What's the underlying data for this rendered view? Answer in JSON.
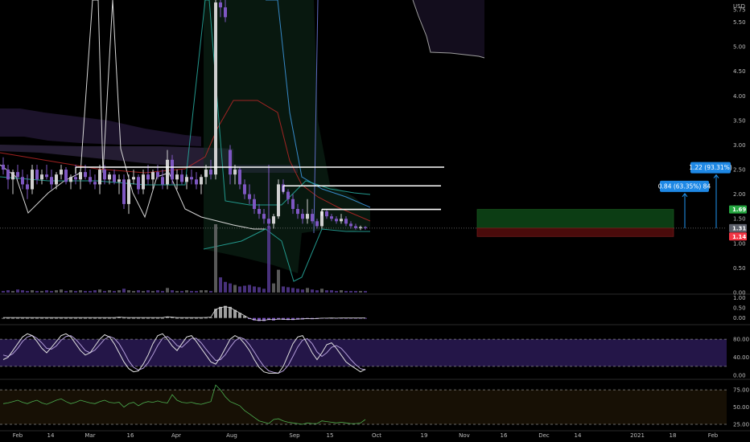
{
  "chart_data": {
    "type": "candlestick",
    "currency": "USD",
    "price_axis": {
      "ticks": [
        "5.75",
        "5.50",
        "5.00",
        "4.50",
        "4.00",
        "3.50",
        "3.00",
        "2.50",
        "2.00",
        "1.50",
        "1.00",
        "0.50",
        "0.00"
      ],
      "range": [
        0,
        5.95
      ]
    },
    "price_tags": [
      {
        "label": "1.69",
        "value": 1.69,
        "color": "#26a641"
      },
      {
        "label": "1.31",
        "value": 1.31,
        "color": "#5d606b"
      },
      {
        "label": "1.14",
        "value": 1.14,
        "color": "#f23645"
      }
    ],
    "time_axis": [
      "Feb",
      "14",
      "Mar",
      "16",
      "Apr",
      "Aug",
      "Sep",
      "15",
      "Oct",
      "19",
      "Nov",
      "16",
      "Dec",
      "14",
      "2021",
      "18",
      "Feb"
    ],
    "candles": [
      [
        2.6,
        2.75,
        2.4,
        2.5
      ],
      [
        2.5,
        2.6,
        2.1,
        2.3
      ],
      [
        2.3,
        2.5,
        2.0,
        2.45
      ],
      [
        2.45,
        2.6,
        2.3,
        2.35
      ],
      [
        2.35,
        2.5,
        2.1,
        2.2
      ],
      [
        2.2,
        2.4,
        1.9,
        2.1
      ],
      [
        2.1,
        2.6,
        2.0,
        2.5
      ],
      [
        2.5,
        2.6,
        2.2,
        2.3
      ],
      [
        2.3,
        2.5,
        2.2,
        2.4
      ],
      [
        2.4,
        2.6,
        2.3,
        2.35
      ],
      [
        2.35,
        2.5,
        2.1,
        2.2
      ],
      [
        2.2,
        2.45,
        2.1,
        2.4
      ],
      [
        2.4,
        2.6,
        2.3,
        2.5
      ],
      [
        2.5,
        2.55,
        2.2,
        2.25
      ],
      [
        2.25,
        2.4,
        2.1,
        2.35
      ],
      [
        2.35,
        2.6,
        2.2,
        2.3
      ],
      [
        2.3,
        2.5,
        2.1,
        2.45
      ],
      [
        2.45,
        2.6,
        2.3,
        2.35
      ],
      [
        2.35,
        2.5,
        2.2,
        2.25
      ],
      [
        2.25,
        2.4,
        2.1,
        2.2
      ],
      [
        2.2,
        2.6,
        2.0,
        2.5
      ],
      [
        2.5,
        2.6,
        2.2,
        2.3
      ],
      [
        2.3,
        2.45,
        2.2,
        2.4
      ],
      [
        2.4,
        2.5,
        2.2,
        2.25
      ],
      [
        2.25,
        2.4,
        2.0,
        2.3
      ],
      [
        2.3,
        2.4,
        1.7,
        1.8
      ],
      [
        1.8,
        2.4,
        1.6,
        2.3
      ],
      [
        2.3,
        2.5,
        2.2,
        2.35
      ],
      [
        2.35,
        2.4,
        2.0,
        2.1
      ],
      [
        2.1,
        2.5,
        2.0,
        2.4
      ],
      [
        2.4,
        2.6,
        2.2,
        2.3
      ],
      [
        2.3,
        2.5,
        2.1,
        2.45
      ],
      [
        2.45,
        2.6,
        2.3,
        2.35
      ],
      [
        2.35,
        2.5,
        2.1,
        2.2
      ],
      [
        2.2,
        2.9,
        2.1,
        2.7
      ],
      [
        2.7,
        2.8,
        2.2,
        2.3
      ],
      [
        2.3,
        2.5,
        2.1,
        2.4
      ],
      [
        2.4,
        2.5,
        2.2,
        2.25
      ],
      [
        2.25,
        2.4,
        2.1,
        2.35
      ],
      [
        2.35,
        2.5,
        2.2,
        2.3
      ],
      [
        2.3,
        2.45,
        2.1,
        2.2
      ],
      [
        2.2,
        2.4,
        2.0,
        2.35
      ],
      [
        2.35,
        2.6,
        2.2,
        2.5
      ],
      [
        2.5,
        2.7,
        2.3,
        2.4
      ],
      [
        2.4,
        6.2,
        2.3,
        5.9
      ],
      [
        5.9,
        6.1,
        5.6,
        5.8
      ],
      [
        5.8,
        6.0,
        5.5,
        5.6
      ],
      [
        2.9,
        3.0,
        2.2,
        2.4
      ],
      [
        2.4,
        2.6,
        2.2,
        2.5
      ],
      [
        2.5,
        2.55,
        2.1,
        2.2
      ],
      [
        2.2,
        2.3,
        1.9,
        2.0
      ],
      [
        2.0,
        2.2,
        1.8,
        1.9
      ],
      [
        1.9,
        2.0,
        1.6,
        1.7
      ],
      [
        1.7,
        1.8,
        1.5,
        1.6
      ],
      [
        1.6,
        1.7,
        1.4,
        1.5
      ],
      [
        1.5,
        2.6,
        1.3,
        1.4
      ],
      [
        1.4,
        1.6,
        1.3,
        1.55
      ],
      [
        1.55,
        2.3,
        1.5,
        2.2
      ],
      [
        2.2,
        2.3,
        2.0,
        2.05
      ],
      [
        2.05,
        2.1,
        1.8,
        1.9
      ],
      [
        1.9,
        2.0,
        1.6,
        1.7
      ],
      [
        1.7,
        1.8,
        1.5,
        1.6
      ],
      [
        1.6,
        1.7,
        1.4,
        1.5
      ],
      [
        1.5,
        1.9,
        1.4,
        1.6
      ],
      [
        1.6,
        1.7,
        1.4,
        1.45
      ],
      [
        1.45,
        1.5,
        1.3,
        1.35
      ],
      [
        1.35,
        1.7,
        1.3,
        1.65
      ],
      [
        1.65,
        1.7,
        1.5,
        1.55
      ],
      [
        1.55,
        1.6,
        1.45,
        1.5
      ],
      [
        1.5,
        1.55,
        1.4,
        1.45
      ],
      [
        1.45,
        1.6,
        1.4,
        1.5
      ],
      [
        1.5,
        1.55,
        1.35,
        1.4
      ],
      [
        1.4,
        1.45,
        1.3,
        1.35
      ],
      [
        1.35,
        1.4,
        1.28,
        1.31
      ],
      [
        1.31,
        1.36,
        1.27,
        1.33
      ],
      [
        1.33,
        1.35,
        1.28,
        1.31
      ]
    ],
    "resistance_lines": [
      {
        "value": 2.55,
        "from_index": 15
      },
      {
        "value": 2.17,
        "from_index": 58
      },
      {
        "value": 1.69,
        "from_index": 66
      }
    ],
    "position_box": {
      "entry": 1.31,
      "target": 1.69,
      "stop": 1.14
    },
    "measures": [
      {
        "label": "0.84 (63.35%) 84",
        "from": 1.31,
        "to": 2.16
      },
      {
        "label": "1.22 (93.31%)",
        "from": 1.31,
        "to": 2.54
      }
    ],
    "volume": [
      2,
      3,
      2,
      4,
      3,
      2,
      3,
      2,
      2,
      3,
      2,
      3,
      4,
      2,
      3,
      2,
      3,
      2,
      2,
      3,
      4,
      2,
      3,
      2,
      3,
      5,
      3,
      2,
      3,
      2,
      3,
      2,
      3,
      2,
      6,
      3,
      2,
      2,
      3,
      2,
      2,
      3,
      3,
      2,
      90,
      20,
      14,
      12,
      10,
      8,
      9,
      10,
      8,
      7,
      5,
      88,
      12,
      30,
      8,
      7,
      6,
      5,
      4,
      6,
      4,
      3,
      5,
      3,
      3,
      2,
      3,
      2,
      2,
      2,
      2,
      2
    ],
    "momentum_axis": {
      "ticks": [
        "1.00",
        "0.50",
        "0.00"
      ],
      "range": [
        -0.25,
        1.1
      ]
    },
    "momentum": [
      0,
      0,
      0,
      0,
      0,
      0,
      0,
      0,
      0,
      0,
      0,
      0,
      0,
      0,
      0,
      0,
      0,
      0,
      0,
      0,
      0,
      0,
      0,
      0,
      0.02,
      0.01,
      0,
      0,
      0,
      0,
      0,
      0,
      0,
      0,
      0.05,
      0.02,
      0,
      0,
      0,
      0,
      0,
      0,
      0.01,
      0.02,
      0.45,
      0.55,
      0.6,
      0.55,
      0.4,
      0.25,
      0.1,
      -0.05,
      -0.12,
      -0.15,
      -0.15,
      -0.1,
      -0.12,
      -0.08,
      -0.09,
      -0.1,
      -0.1,
      -0.08,
      -0.07,
      -0.05,
      -0.06,
      -0.05,
      -0.03,
      -0.03,
      -0.02,
      -0.03,
      -0.02,
      -0.02,
      -0.02,
      -0.02,
      -0.02,
      -0.02
    ],
    "stoch_axis": {
      "ticks": [
        "80.00",
        "40.00",
        "0.00"
      ],
      "range": [
        -5,
        105
      ],
      "band": [
        20,
        80
      ]
    },
    "stoch_k": [
      35,
      40,
      55,
      70,
      85,
      92,
      88,
      75,
      60,
      50,
      62,
      75,
      88,
      92,
      85,
      70,
      55,
      45,
      50,
      65,
      80,
      90,
      85,
      70,
      50,
      30,
      15,
      8,
      10,
      25,
      45,
      70,
      88,
      92,
      80,
      65,
      55,
      70,
      85,
      88,
      75,
      60,
      45,
      30,
      25,
      40,
      60,
      80,
      88,
      82,
      70,
      55,
      35,
      18,
      8,
      5,
      5,
      5,
      20,
      45,
      70,
      85,
      88,
      70,
      50,
      35,
      50,
      68,
      72,
      60,
      45,
      30,
      22,
      15,
      8,
      14
    ],
    "stoch_d": [
      45,
      42,
      48,
      60,
      75,
      85,
      88,
      82,
      72,
      60,
      58,
      65,
      78,
      86,
      88,
      80,
      68,
      55,
      50,
      56,
      68,
      80,
      86,
      82,
      70,
      52,
      32,
      18,
      12,
      16,
      28,
      46,
      66,
      82,
      86,
      78,
      66,
      62,
      72,
      82,
      82,
      72,
      58,
      45,
      33,
      35,
      46,
      62,
      76,
      84,
      80,
      68,
      52,
      35,
      20,
      10,
      7,
      5,
      10,
      22,
      42,
      63,
      78,
      81,
      70,
      52,
      42,
      50,
      62,
      66,
      60,
      48,
      35,
      24,
      15,
      12
    ],
    "rsi_axis": {
      "ticks": [
        "75.00",
        "50.00",
        "25.00"
      ],
      "range": [
        18,
        88
      ],
      "band": [
        25,
        75
      ]
    },
    "rsi": [
      55,
      56,
      58,
      60,
      57,
      55,
      58,
      60,
      56,
      54,
      57,
      60,
      62,
      58,
      55,
      57,
      60,
      58,
      56,
      55,
      58,
      60,
      57,
      56,
      57,
      50,
      55,
      57,
      52,
      56,
      58,
      57,
      59,
      57,
      56,
      68,
      60,
      57,
      56,
      57,
      55,
      54,
      56,
      58,
      82,
      75,
      65,
      58,
      55,
      52,
      45,
      40,
      35,
      30,
      28,
      26,
      32,
      33,
      30,
      28,
      27,
      26,
      25,
      27,
      26,
      26,
      30,
      29,
      28,
      27,
      28,
      27,
      26,
      26,
      27,
      32
    ]
  }
}
